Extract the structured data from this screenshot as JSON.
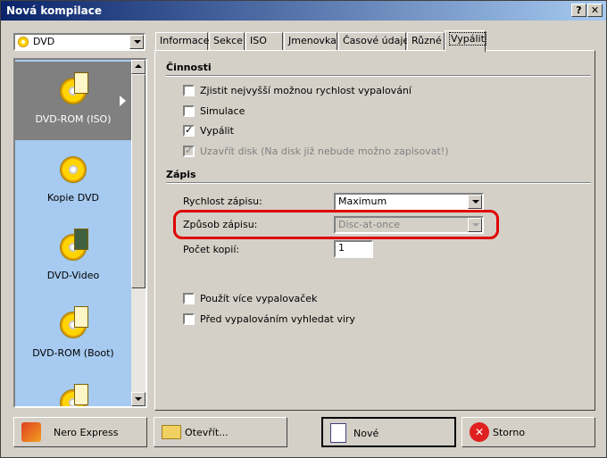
{
  "window": {
    "title": "Nová kompilace"
  },
  "titlebar": {
    "help": "?",
    "close": "✕"
  },
  "disc_type": {
    "value": "DVD"
  },
  "left_list": {
    "items": [
      {
        "label": "DVD-ROM (ISO)",
        "selected": true
      },
      {
        "label": "Kopie DVD"
      },
      {
        "label": "DVD-Video"
      },
      {
        "label": "DVD-ROM (Boot)"
      },
      {
        "label": ""
      }
    ]
  },
  "tabs": [
    "Informace",
    "Sekce",
    "ISO",
    "Jmenovka",
    "Časové údaje",
    "Různé",
    "Vypálit"
  ],
  "active_tab": "Vypálit",
  "cinnosti": {
    "title": "Činnosti",
    "items": [
      {
        "label": "Zjistit nejvyšší možnou rychlost vypalování",
        "checked": false,
        "enabled": true
      },
      {
        "label": "Simulace",
        "checked": false,
        "enabled": true
      },
      {
        "label": "Vypálit",
        "checked": true,
        "enabled": true
      },
      {
        "label": "Uzavřít disk (Na disk již nebude možno zapisovat!)",
        "checked": true,
        "enabled": false
      }
    ]
  },
  "zapis": {
    "title": "Zápis",
    "speed_label": "Rychlost zápisu:",
    "speed_value": "Maximum",
    "method_label": "Způsob zápisu:",
    "method_value": "Disc-at-once",
    "copies_label": "Počet kopií:",
    "copies_value": "1"
  },
  "options": [
    {
      "label": "Použít více vypalovaček",
      "checked": false
    },
    {
      "label": "Před vypalováním vyhledat viry",
      "checked": false
    }
  ],
  "buttons": {
    "nero_express": "Nero Express",
    "open": "Otevřít...",
    "new": "Nové",
    "cancel": "Storno"
  },
  "colors": {
    "highlight": "#e00000",
    "list_bg": "#a6caf0",
    "title_bg": "#0a246a"
  }
}
